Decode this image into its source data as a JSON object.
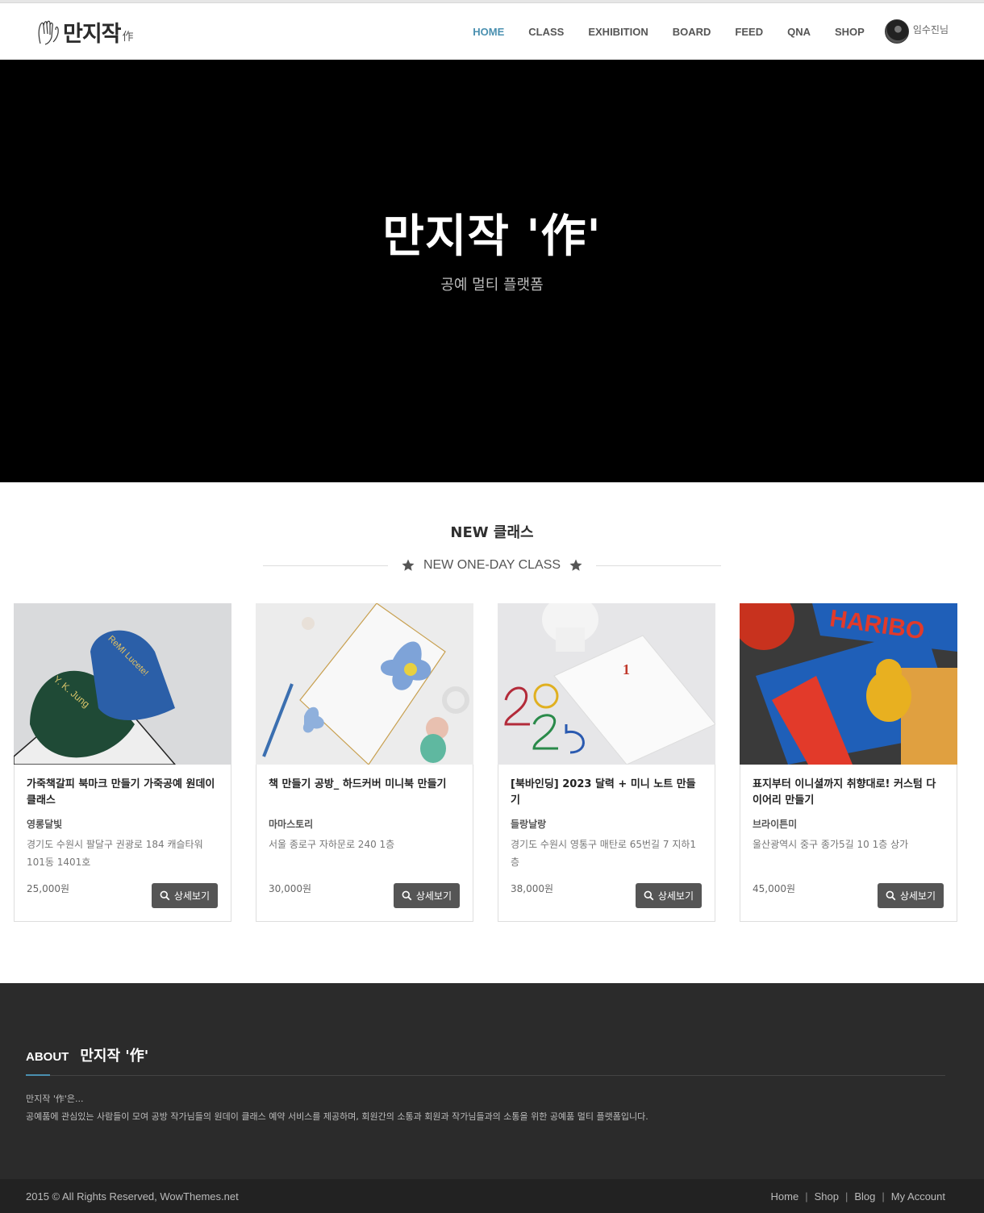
{
  "brand": {
    "logo_text": "만지작",
    "logo_sub": "作"
  },
  "nav": {
    "items": [
      {
        "label": "HOME",
        "active": true
      },
      {
        "label": "CLASS"
      },
      {
        "label": "EXHIBITION"
      },
      {
        "label": "BOARD"
      },
      {
        "label": "FEED"
      },
      {
        "label": "QNA"
      },
      {
        "label": "SHOP"
      }
    ],
    "user_name": "임수진님",
    "active_color": "#4a90b0"
  },
  "hero": {
    "title": "만지작 '作'",
    "subtitle": "공예 멀티 플랫폼"
  },
  "section": {
    "title": "NEW 클래스",
    "subtitle": "NEW ONE-DAY CLASS"
  },
  "cards": [
    {
      "title": "가죽책갈피 북마크 만들기 가죽공예 원데이클래스",
      "shop": "영롱달빛",
      "address": "경기도 수원시 팔달구 권광로 184 캐슬타워 101동 1401호",
      "price": "25,000원",
      "button": "상세보기"
    },
    {
      "title": "책 만들기 공방_ 하드커버 미니북 만들기",
      "shop": "마마스토리",
      "address": "서울 종로구 자하문로 240 1층",
      "price": "30,000원",
      "button": "상세보기"
    },
    {
      "title": "[북바인딩] 2023 달력 + 미니 노트 만들기",
      "shop": "들랑날랑",
      "address": "경기도 수원시 영통구 매탄로 65번길 7 지하1층",
      "price": "38,000원",
      "button": "상세보기"
    },
    {
      "title": "표지부터 이니셜까지 취향대로! 커스텀 다이어리 만들기",
      "shop": "브라이튼미",
      "address": "울산광역시 중구 종가5길 10 1층 상가",
      "price": "45,000원",
      "button": "상세보기"
    }
  ],
  "footer": {
    "about_label": "ABOUT",
    "about_title": "만지작 '作'",
    "about_line1": "만지작 '作'은...",
    "about_line2": "공예품에 관심있는 사람들이 모여 공방 작가님들의 원데이 클래스 예약 서비스를 제공하며, 회원간의 소통과 회원과 작가님들과의 소통을 위한 공예품 멀티 플랫폼입니다.",
    "copyright": "2015 © All Rights Reserved, WowThemes.net",
    "links": [
      "Home",
      "Shop",
      "Blog",
      "My Account"
    ]
  },
  "image_texts": {
    "bookmark1": "Y. K. Jung",
    "bookmark2": "ReMI Lucete!",
    "calendar_month": "1",
    "haribo": "HARIBO"
  }
}
